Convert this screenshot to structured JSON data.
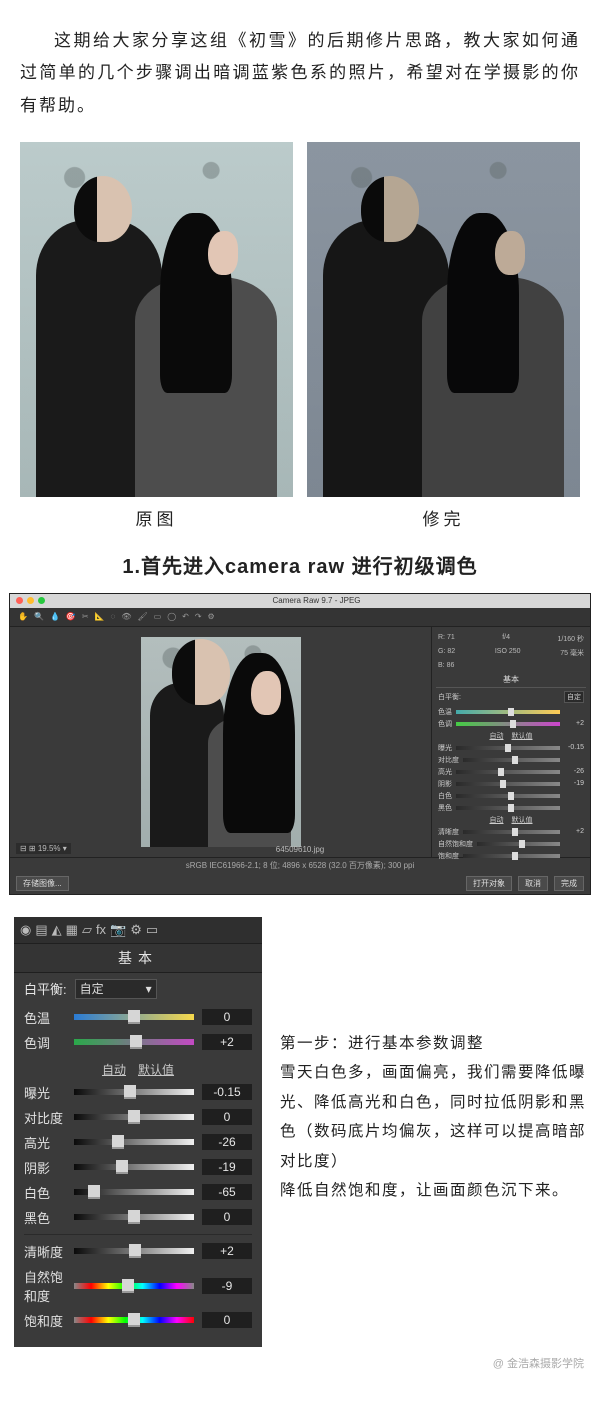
{
  "intro_text": "这期给大家分享这组《初雪》的后期修片思路，教大家如何通过简单的几个步骤调出暗调蓝紫色系的照片，希望对在学摄影的你有帮助。",
  "compare": {
    "original_caption": "原图",
    "edited_caption": "修完"
  },
  "section1_title": "1.首先进入camera raw 进行初级调色",
  "camera_raw": {
    "window_title": "Camera Raw 9.7 - JPEG",
    "toolbar_icons": [
      "hand",
      "zoom",
      "wb",
      "sampler",
      "crop",
      "straighten",
      "spot",
      "redeye",
      "adjust",
      "grad",
      "radial",
      "brush",
      "rotate-l",
      "rotate-r",
      "prefs"
    ],
    "zoom_display": "19.5%",
    "filename": "64509610.jpg",
    "profile_line": "sRGB IEC61966-2.1; 8 位; 4896 x 6528 (32.0 百万像素); 300 ppi",
    "histogram_info": {
      "R": "71",
      "G": "82",
      "B": "86",
      "aperture": "f/4",
      "shutter": "1/160 秒",
      "iso": "ISO 250",
      "focal": "75 毫米"
    },
    "panel_name": "基本",
    "wb_label": "白平衡:",
    "wb_value": "自定",
    "auto": "自动",
    "default": "默认值",
    "sliders": [
      {
        "label": "色温",
        "value": "",
        "pos": 50
      },
      {
        "label": "色调",
        "value": "+2",
        "pos": 52
      },
      {
        "label": "曝光",
        "value": "-0.15",
        "pos": 47
      },
      {
        "label": "对比度",
        "value": "",
        "pos": 50
      },
      {
        "label": "高光",
        "value": "-26",
        "pos": 40
      },
      {
        "label": "阴影",
        "value": "-19",
        "pos": 42
      },
      {
        "label": "白色",
        "value": "",
        "pos": 50
      },
      {
        "label": "黑色",
        "value": "",
        "pos": 50
      },
      {
        "label": "清晰度",
        "value": "+2",
        "pos": 51
      },
      {
        "label": "自然饱和度",
        "value": "",
        "pos": 50
      },
      {
        "label": "饱和度",
        "value": "",
        "pos": 50
      }
    ],
    "buttons": {
      "save_image": "存储图像...",
      "open_object": "打开对象",
      "cancel": "取消",
      "done": "完成"
    }
  },
  "basic_panel": {
    "tab_icons": [
      "lens",
      "tone",
      "detail",
      "hsl",
      "split",
      "fx",
      "camera",
      "preset",
      "snapshot"
    ],
    "heading": "基本",
    "wb_label": "白平衡:",
    "wb_value": "自定",
    "auto_link": "自动",
    "default_link": "默认值",
    "rows": [
      {
        "label": "色温",
        "value": "0",
        "type": "temp",
        "pos": 50
      },
      {
        "label": "色调",
        "value": "+2",
        "type": "tint",
        "pos": 52
      },
      {
        "divider": true,
        "links": true
      },
      {
        "label": "曝光",
        "value": "-0.15",
        "type": "gray",
        "pos": 47
      },
      {
        "label": "对比度",
        "value": "0",
        "type": "gray",
        "pos": 50
      },
      {
        "label": "高光",
        "value": "-26",
        "type": "gray",
        "pos": 37
      },
      {
        "label": "阴影",
        "value": "-19",
        "type": "gray",
        "pos": 40
      },
      {
        "label": "白色",
        "value": "-65",
        "type": "gray",
        "pos": 17
      },
      {
        "label": "黑色",
        "value": "0",
        "type": "gray",
        "pos": 50
      },
      {
        "divider": true
      },
      {
        "label": "清晰度",
        "value": "+2",
        "type": "gray",
        "pos": 51
      },
      {
        "label": "自然饱和度",
        "value": "-9",
        "type": "grad-sv",
        "pos": 45
      },
      {
        "label": "饱和度",
        "value": "0",
        "type": "grad-sat",
        "pos": 50
      }
    ]
  },
  "step1": {
    "title": "第一步：进行基本参数调整",
    "line2": "雪天白色多，画面偏亮，我们需要降低曝光、降低高光和白色，同时拉低阴影和黑色（数码底片均偏灰，这样可以提高暗部对比度）",
    "line3": "降低自然饱和度，让画面颜色沉下来。"
  },
  "watermark": "@ 金浩森摄影学院",
  "chart_data": {
    "type": "table",
    "title": "Camera Raw 基本面板参数",
    "series": [
      {
        "name": "色温",
        "value": 0
      },
      {
        "name": "色调",
        "value": 2
      },
      {
        "name": "曝光",
        "value": -0.15
      },
      {
        "name": "对比度",
        "value": 0
      },
      {
        "name": "高光",
        "value": -26
      },
      {
        "name": "阴影",
        "value": -19
      },
      {
        "name": "白色",
        "value": -65
      },
      {
        "name": "黑色",
        "value": 0
      },
      {
        "name": "清晰度",
        "value": 2
      },
      {
        "name": "自然饱和度",
        "value": -9
      },
      {
        "name": "饱和度",
        "value": 0
      }
    ]
  }
}
